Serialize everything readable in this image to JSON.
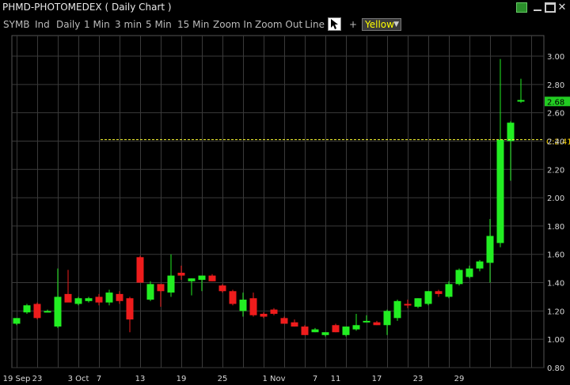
{
  "window": {
    "title": "PHMD-PHOTOMEDEX ( Daily Chart )",
    "close_glyph": "✕"
  },
  "toolbar": {
    "items": [
      "SYMB",
      "Ind",
      "Daily",
      "1 Min",
      "3 min",
      "5 Min",
      "15 Min",
      "Zoom In",
      "Zoom Out",
      "Line"
    ],
    "plus": "+",
    "color_value": "Yellow",
    "cursor_icon": "arrow-cursor-icon"
  },
  "colors": {
    "up": "#22ee22",
    "down": "#ee1c1c",
    "grid": "#3a3a3a",
    "last_price_bg": "#22cc22",
    "close_line": "#ffff33"
  },
  "chart_data": {
    "type": "candlestick",
    "ylim": [
      0.8,
      3.0
    ],
    "yticks": [
      0.8,
      1.0,
      1.2,
      1.4,
      1.6,
      1.8,
      2.0,
      2.2,
      2.4,
      2.6,
      2.8,
      3.0
    ],
    "ytick_labels": [
      "0.80",
      "1.00",
      "1.20",
      "1.40",
      "1.60",
      "1.80",
      "2.00",
      "2.20",
      "2.40",
      "2.60",
      "2.80",
      "3.00"
    ],
    "xtick_labels": [
      {
        "label": "19 Sep",
        "index": 0
      },
      {
        "label": "23",
        "index": 2
      },
      {
        "label": "3 Oct",
        "index": 6
      },
      {
        "label": "7",
        "index": 8
      },
      {
        "label": "13",
        "index": 12
      },
      {
        "label": "19",
        "index": 16
      },
      {
        "label": "25",
        "index": 20
      },
      {
        "label": "1 Nov",
        "index": 25
      },
      {
        "label": "7",
        "index": 29
      },
      {
        "label": "11",
        "index": 31
      },
      {
        "label": "17",
        "index": 35
      },
      {
        "label": "23",
        "index": 39
      },
      {
        "label": "29",
        "index": 43
      }
    ],
    "candles": [
      {
        "o": 1.11,
        "h": 1.15,
        "l": 1.1,
        "c": 1.15
      },
      {
        "o": 1.19,
        "h": 1.25,
        "l": 1.18,
        "c": 1.24
      },
      {
        "o": 1.25,
        "h": 1.26,
        "l": 1.14,
        "c": 1.15
      },
      {
        "o": 1.2,
        "h": 1.21,
        "l": 1.19,
        "c": 1.2
      },
      {
        "o": 1.09,
        "h": 1.5,
        "l": 1.08,
        "c": 1.3
      },
      {
        "o": 1.32,
        "h": 1.49,
        "l": 1.27,
        "c": 1.26
      },
      {
        "o": 1.25,
        "h": 1.3,
        "l": 1.24,
        "c": 1.29
      },
      {
        "o": 1.27,
        "h": 1.3,
        "l": 1.26,
        "c": 1.29
      },
      {
        "o": 1.3,
        "h": 1.32,
        "l": 1.24,
        "c": 1.26
      },
      {
        "o": 1.26,
        "h": 1.35,
        "l": 1.24,
        "c": 1.33
      },
      {
        "o": 1.32,
        "h": 1.34,
        "l": 1.25,
        "c": 1.27
      },
      {
        "o": 1.29,
        "h": 1.3,
        "l": 1.05,
        "c": 1.14
      },
      {
        "o": 1.58,
        "h": 1.59,
        "l": 1.4,
        "c": 1.4
      },
      {
        "o": 1.28,
        "h": 1.41,
        "l": 1.27,
        "c": 1.39
      },
      {
        "o": 1.39,
        "h": 1.39,
        "l": 1.23,
        "c": 1.34
      },
      {
        "o": 1.33,
        "h": 1.6,
        "l": 1.3,
        "c": 1.45
      },
      {
        "o": 1.47,
        "h": 1.52,
        "l": 1.42,
        "c": 1.45
      },
      {
        "o": 1.41,
        "h": 1.43,
        "l": 1.31,
        "c": 1.43
      },
      {
        "o": 1.42,
        "h": 1.45,
        "l": 1.34,
        "c": 1.45
      },
      {
        "o": 1.45,
        "h": 1.46,
        "l": 1.41,
        "c": 1.41
      },
      {
        "o": 1.38,
        "h": 1.39,
        "l": 1.33,
        "c": 1.34
      },
      {
        "o": 1.34,
        "h": 1.35,
        "l": 1.24,
        "c": 1.25
      },
      {
        "o": 1.2,
        "h": 1.33,
        "l": 1.16,
        "c": 1.28
      },
      {
        "o": 1.29,
        "h": 1.33,
        "l": 1.16,
        "c": 1.17
      },
      {
        "o": 1.18,
        "h": 1.19,
        "l": 1.15,
        "c": 1.16
      },
      {
        "o": 1.21,
        "h": 1.22,
        "l": 1.17,
        "c": 1.18
      },
      {
        "o": 1.15,
        "h": 1.16,
        "l": 1.11,
        "c": 1.11
      },
      {
        "o": 1.12,
        "h": 1.14,
        "l": 1.09,
        "c": 1.09
      },
      {
        "o": 1.09,
        "h": 1.1,
        "l": 1.03,
        "c": 1.03
      },
      {
        "o": 1.05,
        "h": 1.08,
        "l": 1.05,
        "c": 1.07
      },
      {
        "o": 1.03,
        "h": 1.05,
        "l": 1.02,
        "c": 1.05
      }
    ],
    "candles_tail": [
      {
        "o": 1.1,
        "h": 1.11,
        "l": 1.05,
        "c": 1.05
      },
      {
        "o": 1.03,
        "h": 1.09,
        "l": 1.02,
        "c": 1.09
      },
      {
        "o": 1.07,
        "h": 1.18,
        "l": 1.06,
        "c": 1.1
      },
      {
        "o": 1.13,
        "h": 1.17,
        "l": 1.12,
        "c": 1.13
      },
      {
        "o": 1.12,
        "h": 1.13,
        "l": 1.1,
        "c": 1.1
      },
      {
        "o": 1.1,
        "h": 1.21,
        "l": 1.03,
        "c": 1.2
      },
      {
        "o": 1.15,
        "h": 1.28,
        "l": 1.13,
        "c": 1.27
      },
      {
        "o": 1.25,
        "h": 1.28,
        "l": 1.22,
        "c": 1.24
      },
      {
        "o": 1.23,
        "h": 1.29,
        "l": 1.22,
        "c": 1.29
      },
      {
        "o": 1.25,
        "h": 1.34,
        "l": 1.24,
        "c": 1.34
      },
      {
        "o": 1.34,
        "h": 1.35,
        "l": 1.3,
        "c": 1.32
      },
      {
        "o": 1.3,
        "h": 1.41,
        "l": 1.29,
        "c": 1.39
      },
      {
        "o": 1.39,
        "h": 1.5,
        "l": 1.38,
        "c": 1.49
      },
      {
        "o": 1.44,
        "h": 1.52,
        "l": 1.43,
        "c": 1.5
      },
      {
        "o": 1.5,
        "h": 1.56,
        "l": 1.48,
        "c": 1.55
      },
      {
        "o": 1.54,
        "h": 1.85,
        "l": 1.4,
        "c": 1.73
      },
      {
        "o": 1.68,
        "h": 2.98,
        "l": 1.65,
        "c": 2.41
      },
      {
        "o": 2.4,
        "h": 2.54,
        "l": 2.12,
        "c": 2.53
      },
      {
        "o": 2.68,
        "h": 2.84,
        "l": 2.67,
        "c": 2.69
      }
    ],
    "close_line": {
      "value": 2.41,
      "label": "C:2.41"
    },
    "last_price": {
      "value": 2.68,
      "label": "2.68"
    }
  }
}
